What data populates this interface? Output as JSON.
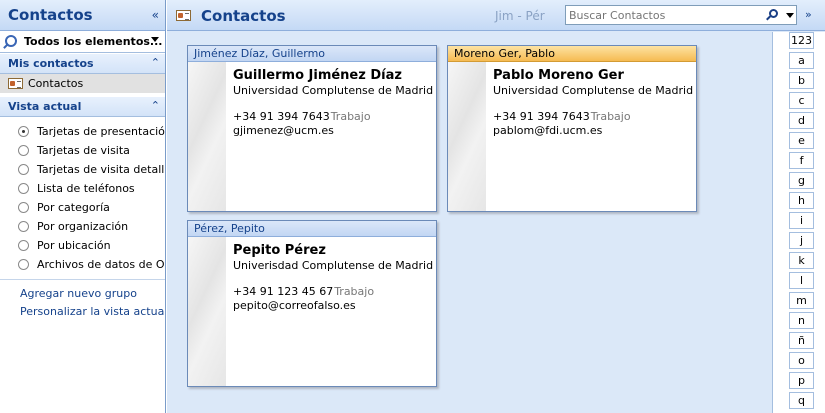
{
  "nav": {
    "title": "Contactos",
    "collapse_glyph": "«",
    "all_items": "Todos los elementos...",
    "mis_contactos": {
      "label": "Mis contactos",
      "chevron": "⌃",
      "items": [
        "Contactos"
      ]
    },
    "vista_actual": {
      "label": "Vista actual",
      "chevron": "⌃",
      "selected_index": 0,
      "options": [
        "Tarjetas de presentación",
        "Tarjetas de visita",
        "Tarjetas de visita detalladas",
        "Lista de teléfonos",
        "Por categoría",
        "Por organización",
        "Por ubicación",
        "Archivos de datos de Outlook"
      ]
    },
    "links": [
      "Agregar nuevo grupo",
      "Personalizar la vista actual..."
    ]
  },
  "main": {
    "title": "Contactos",
    "range": "Jim - Pér",
    "search_placeholder": "Buscar Contactos",
    "expand_glyph": "»"
  },
  "contacts": [
    {
      "header": "Jiménez Díaz, Guillermo",
      "name": "Guillermo Jiménez Díaz",
      "org": "Universidad Complutense de Madrid",
      "phone": "+34 91 394 7643",
      "phone_type": "Trabajo",
      "email": "gjimenez@ucm.es",
      "selected": false
    },
    {
      "header": "Moreno Ger, Pablo",
      "name": "Pablo Moreno Ger",
      "org": "Universidad Complutense de Madrid",
      "phone": "+34 91 394 7643",
      "phone_type": "Trabajo",
      "email": "pablom@fdi.ucm.es",
      "selected": true
    },
    {
      "header": "Pérez, Pepito",
      "name": "Pepito Pérez",
      "org": "Univerisdad Complutense de Madrid",
      "phone": "+34 91 123 45 67",
      "phone_type": "Trabajo",
      "email": "pepito@correofalso.es",
      "selected": false
    }
  ],
  "alphabet": [
    "123",
    "a",
    "b",
    "c",
    "d",
    "e",
    "f",
    "g",
    "h",
    "i",
    "j",
    "k",
    "l",
    "m",
    "n",
    "ñ",
    "o",
    "p",
    "q"
  ],
  "colors": {
    "accent": "#15428b",
    "selected_header": "#f6bb52",
    "main_background": "#dbe8f8"
  }
}
